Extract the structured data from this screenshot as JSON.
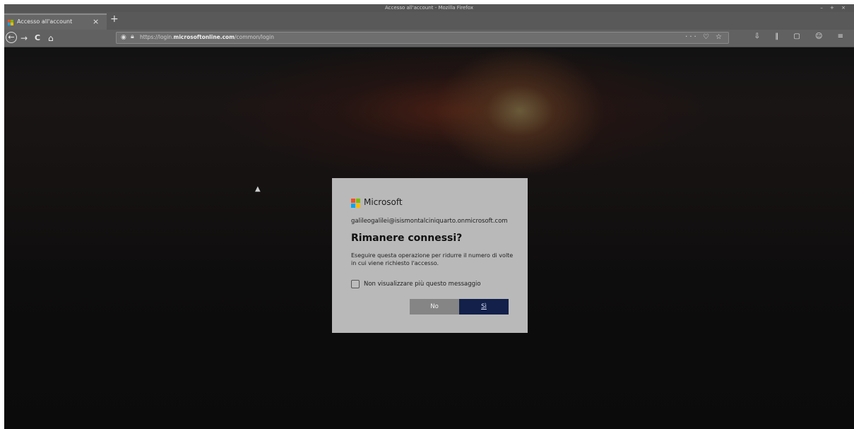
{
  "window": {
    "title": "Accesso all'account - Mozilla Firefox",
    "controls": "– + ×"
  },
  "tab": {
    "title": "Accesso all'account",
    "close": "×",
    "new_tab": "+"
  },
  "nav": {
    "back": "←",
    "forward": "→",
    "reload": "C",
    "home": "⌂",
    "url_prefix": "https://login.",
    "url_domain": "microsoftonline.com",
    "url_path": "/common/login",
    "url_actions": "··· ♡ ☆",
    "toolbar_right": "⇩ ‖ ▢ ☺ ≡"
  },
  "dialog": {
    "brand": "Microsoft",
    "email": "galileogalilei@isismontalciniquarto.onmicrosoft.com",
    "title": "Rimanere connessi?",
    "description": "Eseguire questa operazione per ridurre il numero di volte in cui viene richiesto l'accesso.",
    "checkbox_label": "Non visualizzare più questo messaggio",
    "checkbox_checked": false,
    "no_label": "No",
    "yes_label": "Sì"
  },
  "colors": {
    "logo_red": "#f25022",
    "logo_green": "#7fba00",
    "logo_blue": "#00a4ef",
    "logo_yellow": "#ffb900",
    "primary_button": "#12204a"
  }
}
